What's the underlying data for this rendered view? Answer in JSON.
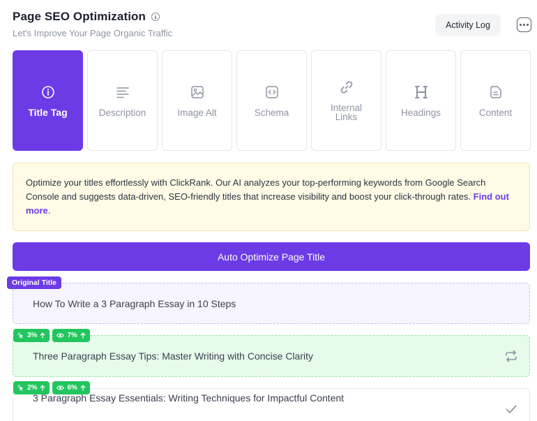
{
  "header": {
    "title": "Page SEO Optimization",
    "subtitle": "Let's Improve Your Page Organic Traffic",
    "activity_log_label": "Activity Log"
  },
  "tabs": [
    {
      "label": "Title Tag",
      "icon": "info-icon",
      "active": true
    },
    {
      "label": "Description",
      "icon": "lines-icon",
      "active": false
    },
    {
      "label": "Image Alt",
      "icon": "image-icon",
      "active": false
    },
    {
      "label": "Schema",
      "icon": "code-icon",
      "active": false
    },
    {
      "label": "Internal Links",
      "icon": "link-icon",
      "active": false
    },
    {
      "label": "Headings",
      "icon": "heading-icon",
      "active": false
    },
    {
      "label": "Content",
      "icon": "document-icon",
      "active": false
    }
  ],
  "banner": {
    "text": "Optimize your titles effortlessly with ClickRank. Our AI analyzes your top-performing keywords from Google Search Console and suggests data-driven, SEO-friendly titles that increase visibility and boost your click-through rates. ",
    "link_label": "Find out more",
    "link_suffix": "."
  },
  "optimize_button_label": "Auto Optimize Page Title",
  "original": {
    "tag_label": "Original Title",
    "text": "How To Write a 3 Paragraph Essay in 10 Steps"
  },
  "suggestions": [
    {
      "ctr": "3%",
      "views": "7%",
      "text": "Three Paragraph Essay Tips: Master Writing with Concise Clarity",
      "action_icon": "regenerate-icon"
    },
    {
      "ctr": "2%",
      "views": "6%",
      "text": "3 Paragraph Essay Essentials: Writing Techniques for Impactful Content",
      "action_icon": "check-icon"
    }
  ],
  "colors": {
    "accent": "#6c3be6",
    "success": "#22c55e",
    "banner_bg": "#fffbe6"
  }
}
